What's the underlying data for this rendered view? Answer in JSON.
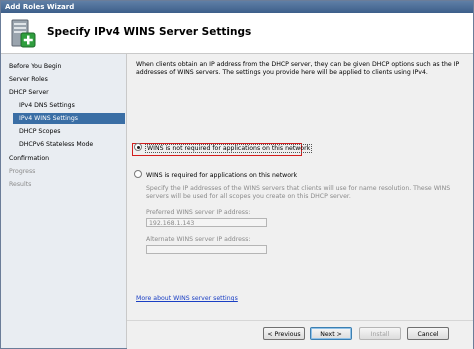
{
  "window": {
    "title": "Add Roles Wizard"
  },
  "header": {
    "title": "Specify IPv4 WINS Server Settings",
    "icon": "server-add-icon"
  },
  "nav": {
    "items": [
      {
        "label": "Before You Begin",
        "state": "normal"
      },
      {
        "label": "Server Roles",
        "state": "normal"
      },
      {
        "label": "DHCP Server",
        "state": "normal"
      },
      {
        "label": "IPv4 DNS Settings",
        "state": "sub"
      },
      {
        "label": "IPv4 WINS Settings",
        "state": "active"
      },
      {
        "label": "DHCP Scopes",
        "state": "sub"
      },
      {
        "label": "DHCPv6 Stateless Mode",
        "state": "sub"
      },
      {
        "label": "Confirmation",
        "state": "normal"
      },
      {
        "label": "Progress",
        "state": "dim"
      },
      {
        "label": "Results",
        "state": "dim"
      }
    ]
  },
  "content": {
    "intro": "When clients obtain an IP address from the DHCP server, they can be given DHCP options such as the IP addresses of WINS servers. The settings you provide here will be applied to clients using IPv4.",
    "option_not_required": "WINS is not required for applications on this network",
    "option_required": "WINS is required for applications on this network",
    "selected_option": "not_required",
    "required_desc": "Specify the IP addresses of the WINS servers that clients will use for name resolution. These WINS servers will be used for all scopes you create on this DHCP server.",
    "preferred_label": "Preferred WINS server IP address:",
    "preferred_value": "192.168.1.143",
    "alternate_label": "Alternate WINS server IP address:",
    "alternate_value": "",
    "more_link": "More about WINS server settings"
  },
  "footer": {
    "previous": "< Previous",
    "next": "Next >",
    "install": "Install",
    "cancel": "Cancel"
  },
  "colors": {
    "highlight": "#d21e1e",
    "active_nav": "#3a6ea5",
    "link": "#1a3fc4"
  }
}
